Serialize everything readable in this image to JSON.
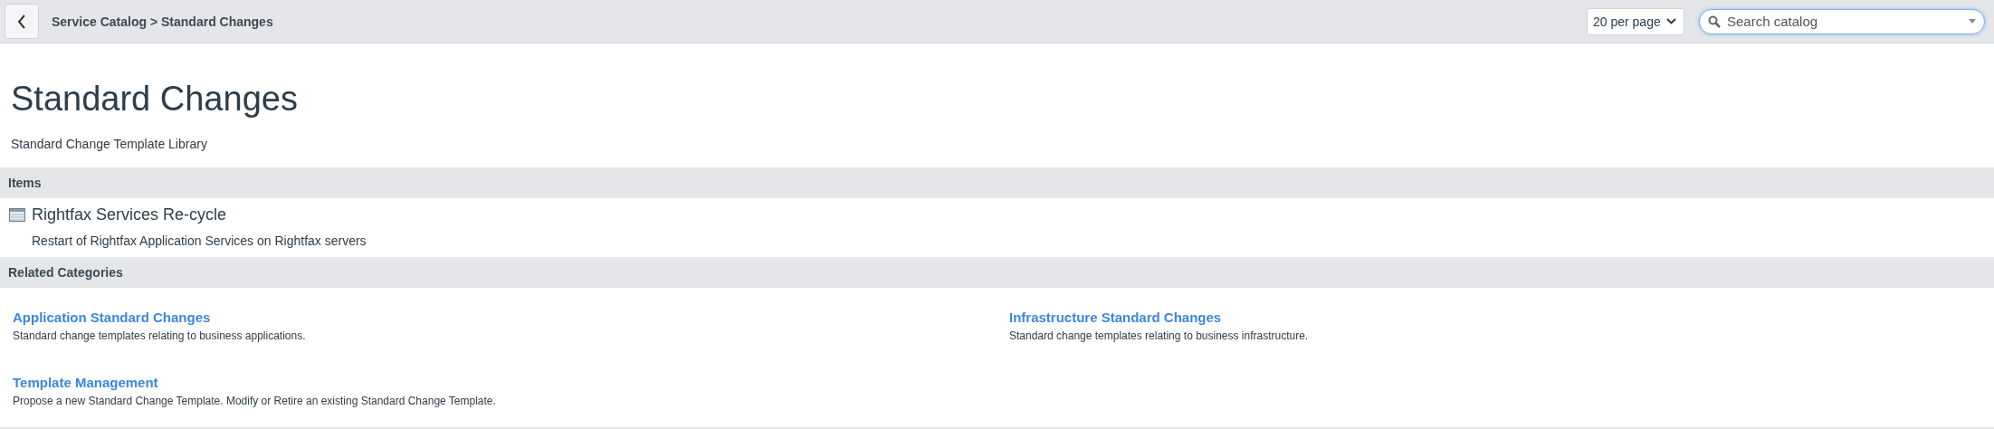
{
  "header": {
    "breadcrumb": "Service Catalog > Standard Changes",
    "per_page": "20 per page",
    "search": {
      "placeholder": "Search catalog"
    }
  },
  "page": {
    "title": "Standard Changes",
    "subtitle": "Standard Change Template Library"
  },
  "items_section": {
    "heading": "Items",
    "items": [
      {
        "title": "Rightfax Services Re-cycle",
        "description": "Restart of Rightfax Application Services on Rightfax servers"
      }
    ]
  },
  "related_section": {
    "heading": "Related Categories",
    "categories": [
      {
        "title": "Application Standard Changes",
        "description": "Standard change templates relating to business applications."
      },
      {
        "title": "Infrastructure Standard Changes",
        "description": "Standard change templates relating to business infrastructure."
      },
      {
        "title": "Template Management",
        "description": "Propose a new Standard Change Template. Modify or Retire an existing Standard Change Template."
      }
    ]
  }
}
